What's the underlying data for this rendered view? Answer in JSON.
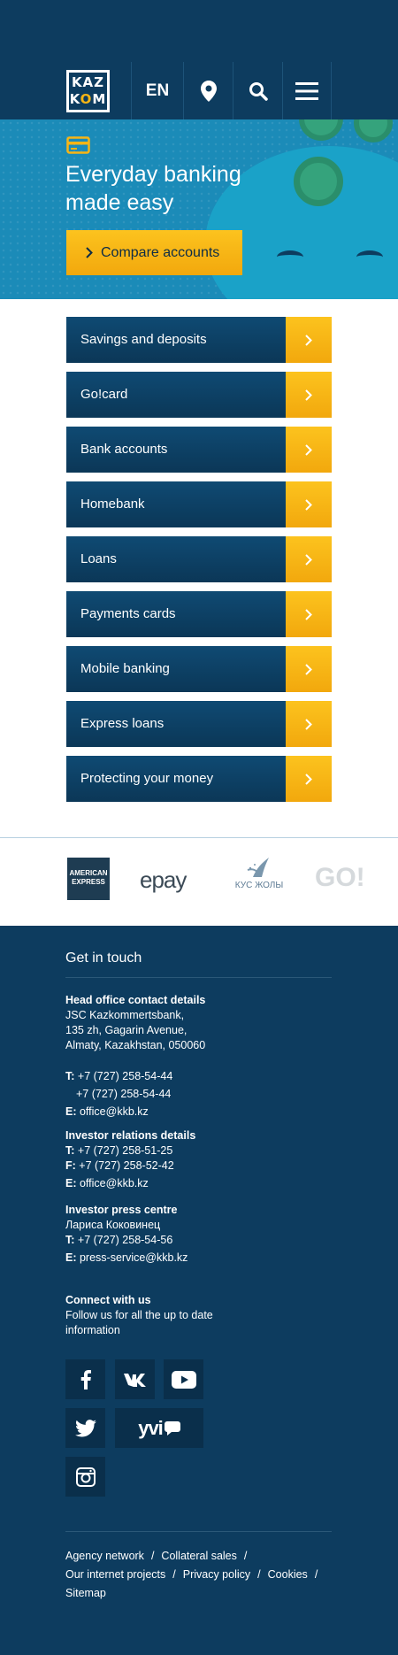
{
  "header": {
    "logo": {
      "line1": "KAZ",
      "line2_k": "K",
      "line2_o": "O",
      "line2_m": "M",
      "alt": "Kazkom"
    },
    "language": "EN",
    "icons": [
      "location-pin-icon",
      "search-icon",
      "menu-icon"
    ]
  },
  "hero": {
    "title": "Everyday banking made easy",
    "cta_label": "Compare accounts",
    "icon": "credit-card-icon"
  },
  "menu": {
    "items": [
      {
        "label": "Savings and deposits"
      },
      {
        "label": "Go!card"
      },
      {
        "label": "Bank accounts"
      },
      {
        "label": "Homebank"
      },
      {
        "label": "Loans"
      },
      {
        "label": "Payments cards"
      },
      {
        "label": "Mobile banking"
      },
      {
        "label": "Express loans"
      },
      {
        "label": "Protecting your money"
      }
    ]
  },
  "partners": {
    "amex": "AMERICAN EXPRESS",
    "epay": "epay",
    "kus": "КУС ЖОЛЫ",
    "kus_sub": "",
    "go": "GO!"
  },
  "footer": {
    "title": "Get in touch",
    "head_office": {
      "heading": "Head office contact details",
      "lines": [
        "JSC Kazkommertsbank,",
        "135 zh, Gagarin Avenue,",
        "Almaty, Kazakhstan, 050060"
      ],
      "tel_label": "T:",
      "tel1": "+7 (727) 258-54-44",
      "tel2": "+7 (727) 258-54-44",
      "email_label": "E:",
      "email": "office@kkb.kz"
    },
    "investor": {
      "heading": "Investor relations details",
      "tel_label": "T:",
      "tel": "+7 (727) 258-51-25",
      "fax_label": "F:",
      "fax": "+7 (727) 258-52-42",
      "email_label": "E:",
      "email": "office@kkb.kz"
    },
    "press": {
      "heading": "Investor press centre",
      "name": "Лариса Коковинец",
      "tel_label": "T:",
      "tel": "+7 (727) 258-54-56",
      "email_label": "E:",
      "email": "press-service@kkb.kz"
    },
    "connect": {
      "heading": "Connect with us",
      "text": "Follow us for all the up to date information"
    },
    "social": {
      "yvi": "yvi"
    },
    "links": [
      "Agency network",
      "Collateral sales",
      "Our internet projects",
      "Privacy policy",
      "Cookies",
      "Sitemap"
    ],
    "link_separator": "/"
  },
  "colors": {
    "navy": "#0d3c5f",
    "accent_yellow": "#f7b515",
    "hero_blue": "#1b8bb8"
  }
}
